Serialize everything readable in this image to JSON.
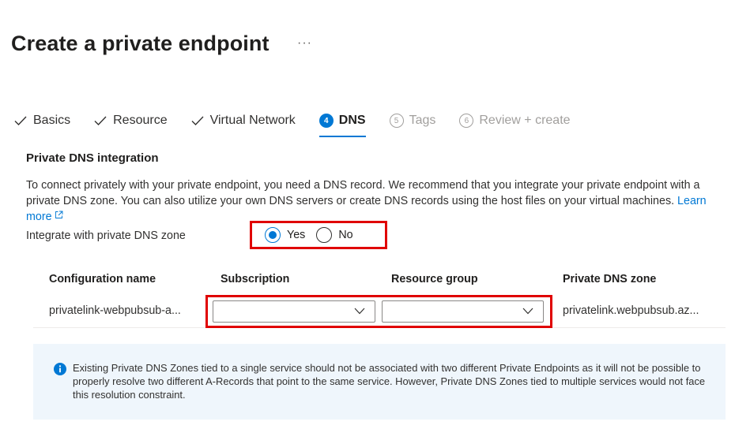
{
  "header": {
    "title": "Create a private endpoint",
    "more": "···"
  },
  "tabs": [
    {
      "label": "Basics",
      "state": "done"
    },
    {
      "label": "Resource",
      "state": "done"
    },
    {
      "label": "Virtual Network",
      "state": "done"
    },
    {
      "number": "4",
      "label": "DNS",
      "state": "active"
    },
    {
      "number": "5",
      "label": "Tags",
      "state": "disabled"
    },
    {
      "number": "6",
      "label": "Review + create",
      "state": "disabled"
    }
  ],
  "section": {
    "heading": "Private DNS integration",
    "description_1": "To connect privately with your private endpoint, you need a DNS record. We recommend that you integrate your private endpoint with a private DNS zone. You can also utilize your own DNS servers or create DNS records using the host files on your virtual machines. ",
    "learn_more": "Learn more"
  },
  "integrate": {
    "label": "Integrate with private DNS zone",
    "yes": "Yes",
    "no": "No",
    "selected": "Yes"
  },
  "grid": {
    "headers": {
      "config": "Configuration name",
      "subscription": "Subscription",
      "resource_group": "Resource group",
      "zone": "Private DNS zone"
    },
    "row": {
      "config": "privatelink-webpubsub-a...",
      "subscription": "",
      "resource_group": "",
      "zone": "privatelink.webpubsub.az..."
    }
  },
  "info": {
    "text": "Existing Private DNS Zones tied to a single service should not be associated with two different Private Endpoints as it will not be possible to properly resolve two different A-Records that point to the same service. However, Private DNS Zones tied to multiple services would not face this resolution constraint."
  },
  "colors": {
    "accent": "#0078d4",
    "highlight": "#e00000",
    "info_bg": "#eff6fc"
  }
}
